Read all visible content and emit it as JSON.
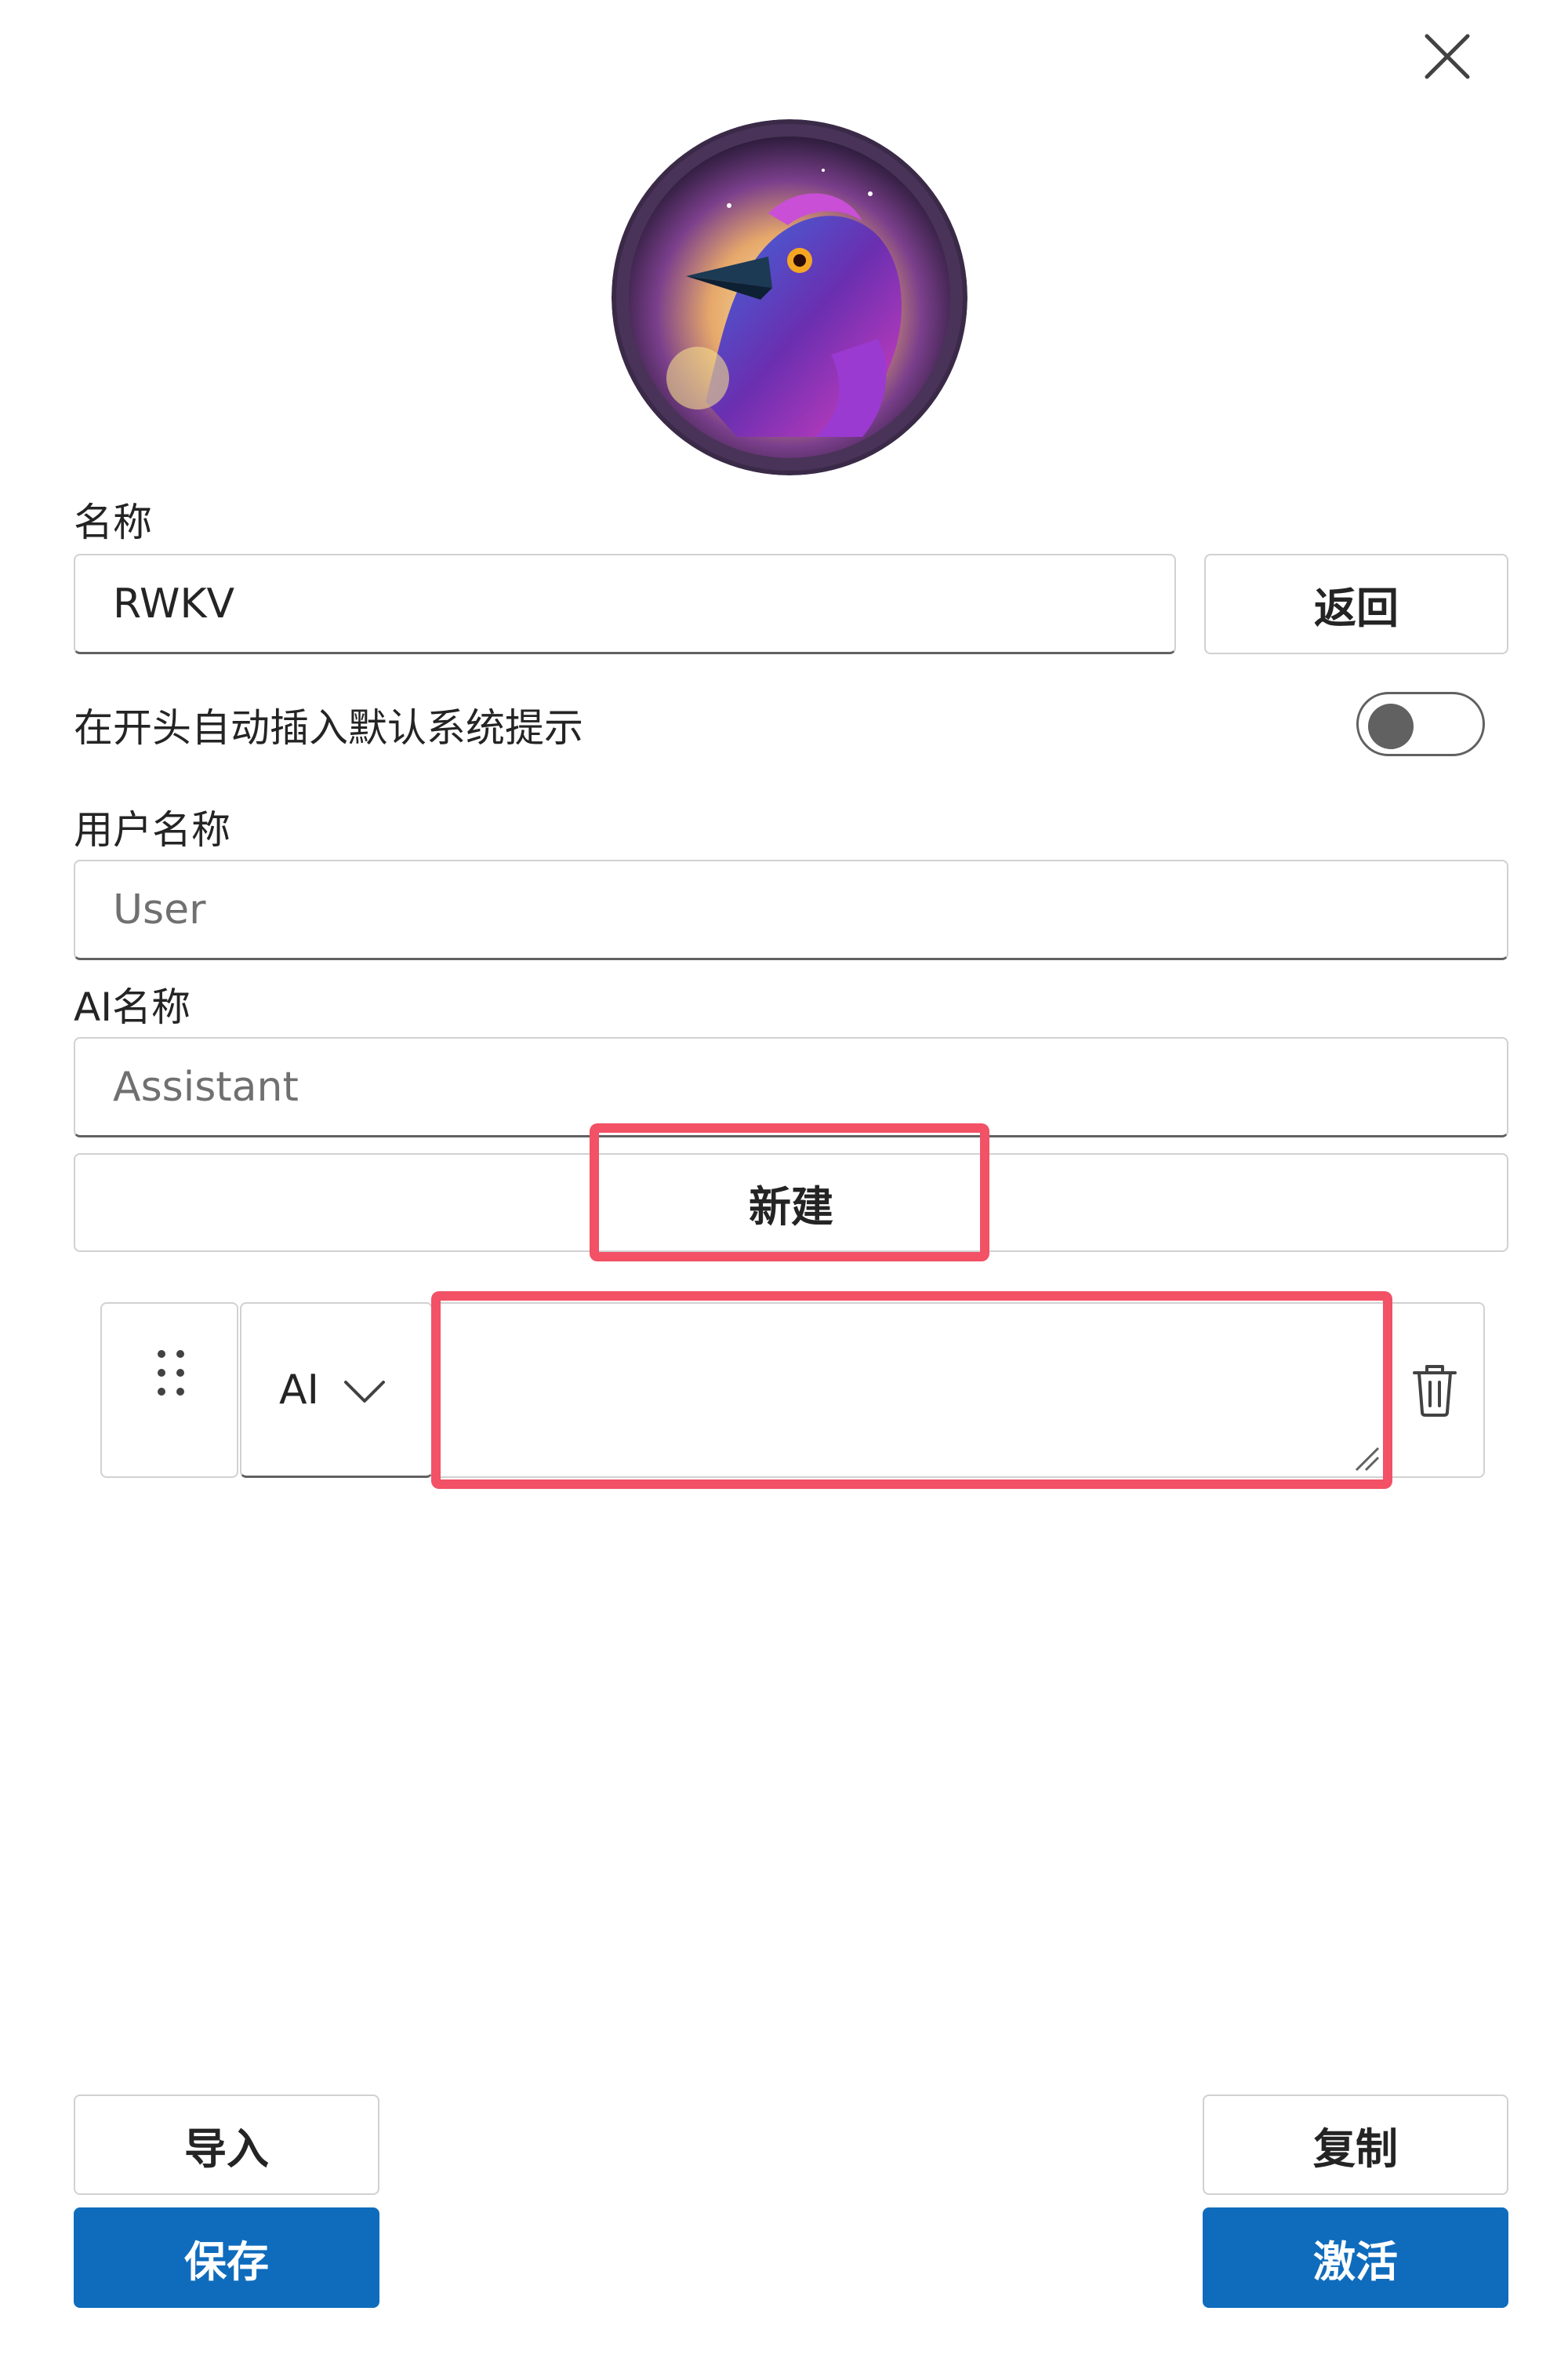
{
  "header": {
    "close_icon": "close-icon"
  },
  "avatar": {
    "icon": "raven-avatar"
  },
  "name": {
    "label": "名称",
    "value": "RWKV",
    "back_button": "返回"
  },
  "system_prompt": {
    "label": "在开头自动插入默认系统提示",
    "enabled": false
  },
  "user_name": {
    "label": "用户名称",
    "placeholder": "User"
  },
  "ai_name": {
    "label": "AI名称",
    "placeholder": "Assistant"
  },
  "new_button": "新建",
  "message": {
    "role": "AI",
    "content": ""
  },
  "footer": {
    "import_button": "导入",
    "save_button": "保存",
    "copy_button": "复制",
    "activate_button": "激活"
  },
  "colors": {
    "primary": "#0f6cbd",
    "highlight": "#f25166",
    "border": "#d1d1d1"
  }
}
